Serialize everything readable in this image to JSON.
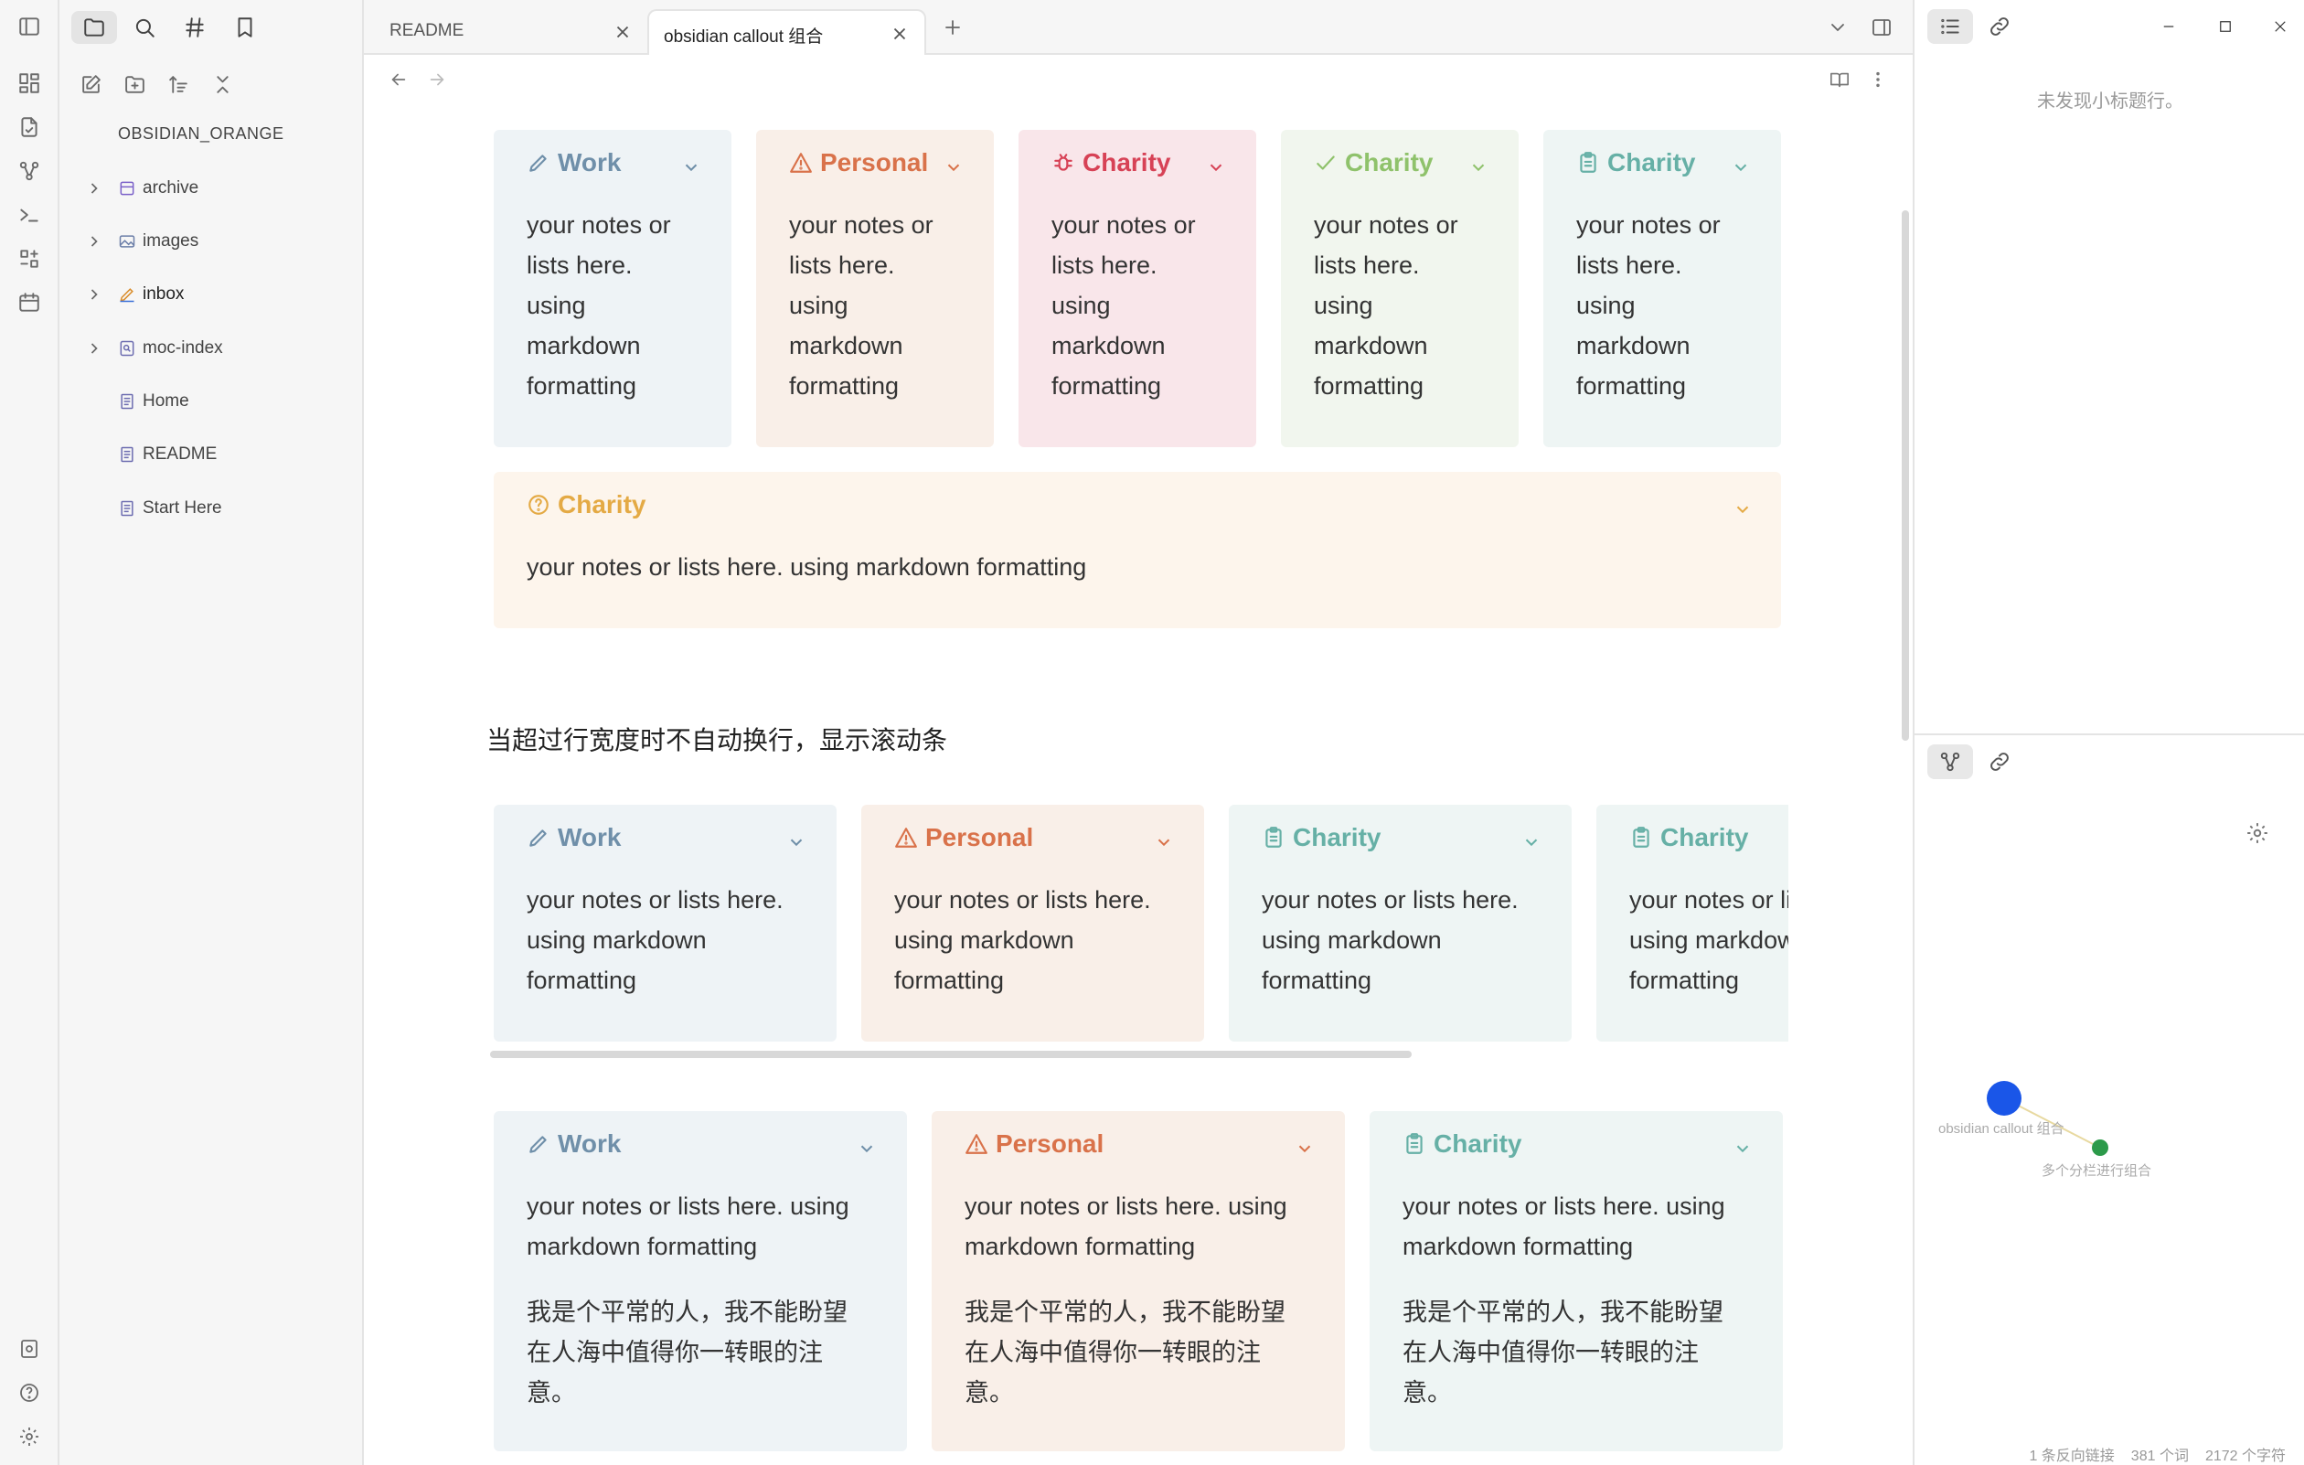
{
  "ribbon": {
    "icons": [
      "sidebar-toggle-icon",
      "canvas-icon",
      "file-switch-icon",
      "graph-icon",
      "terminal-icon",
      "plugins-icon",
      "calendar-icon"
    ],
    "bottom_icons": [
      "vault-icon",
      "help-icon",
      "settings-icon"
    ]
  },
  "sidebar": {
    "tabs": [
      "folder-icon",
      "search-icon",
      "tag-icon",
      "bookmark-icon"
    ],
    "actions": [
      "new-note-icon",
      "new-folder-icon",
      "sort-icon",
      "collapse-icon"
    ],
    "vault_name": "OBSIDIAN_ORANGE",
    "items": [
      {
        "label": "archive",
        "type": "folder",
        "icon": "archive-icon",
        "color": "#7b61c9"
      },
      {
        "label": "images",
        "type": "folder",
        "icon": "image-icon",
        "color": "#6c7fa8"
      },
      {
        "label": "inbox",
        "type": "folder",
        "icon": "pen-icon",
        "color": "#d98c2a"
      },
      {
        "label": "moc-index",
        "type": "folder",
        "icon": "index-icon",
        "color": "#6c6cb0"
      },
      {
        "label": "Home",
        "type": "file",
        "icon": "note-icon",
        "color": "#6c6cb0"
      },
      {
        "label": "README",
        "type": "file",
        "icon": "note-icon",
        "color": "#6c6cb0"
      },
      {
        "label": "Start Here",
        "type": "file",
        "icon": "note-icon",
        "color": "#6c6cb0"
      }
    ]
  },
  "tabs": [
    {
      "label": "README",
      "active": false
    },
    {
      "label": "obsidian callout 组合",
      "active": true
    }
  ],
  "callouts_row1": [
    {
      "title": "Work",
      "kind": "work",
      "icon": "pencil-icon",
      "lines": [
        "your notes or",
        "lists here.",
        "using",
        "markdown",
        "formatting"
      ]
    },
    {
      "title": "Personal",
      "kind": "personal",
      "icon": "warning-icon",
      "lines": [
        "your notes or",
        "lists here.",
        "using",
        "markdown",
        "formatting"
      ]
    },
    {
      "title": "Charity",
      "kind": "charity-red",
      "icon": "bug-icon",
      "lines": [
        "your notes or",
        "lists here.",
        "using",
        "markdown",
        "formatting"
      ]
    },
    {
      "title": "Charity",
      "kind": "charity-green",
      "icon": "check-icon",
      "lines": [
        "your notes or",
        "lists here.",
        "using",
        "markdown",
        "formatting"
      ]
    },
    {
      "title": "Charity",
      "kind": "charity-teal",
      "icon": "clipboard-icon",
      "lines": [
        "your notes or",
        "lists here.",
        "using",
        "markdown",
        "formatting"
      ]
    }
  ],
  "callout_wide": {
    "title": "Charity",
    "kind": "charity-yellow",
    "icon": "question-icon",
    "text": "your notes or lists here. using markdown formatting"
  },
  "heading": "当超过行宽度时不自动换行，显示滚动条",
  "callouts_row2": [
    {
      "title": "Work",
      "kind": "work",
      "icon": "pencil-icon",
      "lines": [
        "your notes or lists here.",
        "using markdown",
        "formatting"
      ]
    },
    {
      "title": "Personal",
      "kind": "personal",
      "icon": "warning-icon",
      "lines": [
        "your notes or lists here.",
        "using markdown",
        "formatting"
      ]
    },
    {
      "title": "Charity",
      "kind": "charity-teal",
      "icon": "clipboard-icon",
      "lines": [
        "your notes or lists here.",
        "using markdown",
        "formatting"
      ]
    },
    {
      "title": "Charity",
      "kind": "charity-teal",
      "icon": "clipboard-icon",
      "lines": [
        "your notes or lists here.",
        "using markdown",
        "formatting"
      ]
    }
  ],
  "callouts_row3": [
    {
      "title": "Work",
      "kind": "work",
      "icon": "pencil-icon",
      "lines": [
        "your notes or lists here. using",
        "markdown formatting"
      ],
      "cn": [
        "我是个平常的人，我不能盼望",
        "在人海中值得你一转眼的注",
        "意。"
      ]
    },
    {
      "title": "Personal",
      "kind": "personal",
      "icon": "warning-icon",
      "lines": [
        "your notes or lists here. using",
        "markdown formatting"
      ],
      "cn": [
        "我是个平常的人，我不能盼望",
        "在人海中值得你一转眼的注",
        "意。"
      ]
    },
    {
      "title": "Charity",
      "kind": "charity-teal",
      "icon": "clipboard-icon",
      "lines": [
        "your notes or lists here. using",
        "markdown formatting"
      ],
      "cn": [
        "我是个平常的人，我不能盼望",
        "在人海中值得你一转眼的注",
        "意。"
      ]
    }
  ],
  "right_panel": {
    "outline_empty": "未发现小标题行。",
    "graph_nodes": [
      {
        "label": "obsidian callout 组合",
        "color": "#1a56e8"
      },
      {
        "label": "多个分栏进行组合",
        "color": "#2c9a4a"
      }
    ],
    "status": [
      "1 条反向链接",
      "381 个词",
      "2172 个字符"
    ]
  }
}
